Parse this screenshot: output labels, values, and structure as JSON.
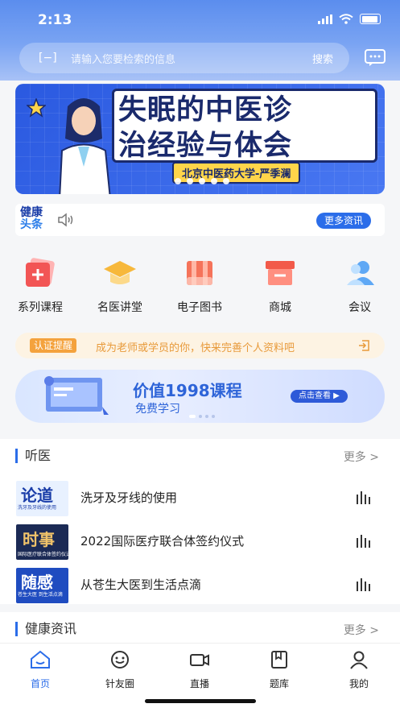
{
  "status": {
    "time": "2:13"
  },
  "search": {
    "placeholder": "请输入您要检索的信息",
    "button": "搜索"
  },
  "banner": {
    "line1": "失眠的中医诊",
    "line2": "治经验与体会",
    "subtitle": "北京中医药大学-严季澜"
  },
  "news": {
    "logo_line1": "健康",
    "logo_line2": "头条",
    "more": "更多资讯"
  },
  "categories": [
    {
      "label": "系列课程",
      "icon": "course-icon"
    },
    {
      "label": "名医讲堂",
      "icon": "lecture-hall-icon"
    },
    {
      "label": "电子图书",
      "icon": "ebook-icon"
    },
    {
      "label": "商城",
      "icon": "shop-icon"
    },
    {
      "label": "会议",
      "icon": "meeting-icon"
    }
  ],
  "notice": {
    "tag": "认证提醒",
    "text": "成为老师或学员的你，快来完善个人资料吧"
  },
  "promo": {
    "title": "价值1998课程",
    "subtitle": "免费学习",
    "button": "点击查看 ▶"
  },
  "listen": {
    "title": "听医",
    "more": "更多 >",
    "items": [
      {
        "title": "洗牙及牙线的使用",
        "thumb_text": "论道",
        "thumb_caption": "洗牙及牙线的使用"
      },
      {
        "title": "2022国际医疗联合体签约仪式",
        "thumb_text": "时事",
        "thumb_caption": "国际医疗联合体签约仪式"
      },
      {
        "title": "从苍生大医到生活点滴",
        "thumb_text": "随感",
        "thumb_caption": "苍生大医 到生活点滴"
      }
    ]
  },
  "health": {
    "title": "健康资讯",
    "more": "更多 >"
  },
  "tabs": [
    {
      "label": "首页",
      "icon": "home-icon",
      "active": true
    },
    {
      "label": "针友圈",
      "icon": "circle-icon",
      "active": false
    },
    {
      "label": "直播",
      "icon": "live-icon",
      "active": false
    },
    {
      "label": "题库",
      "icon": "question-bank-icon",
      "active": false
    },
    {
      "label": "我的",
      "icon": "profile-icon",
      "active": false
    }
  ],
  "colors": {
    "accent": "#2b6de9",
    "notice": "#f4a23d",
    "header": "#5b8dee"
  }
}
